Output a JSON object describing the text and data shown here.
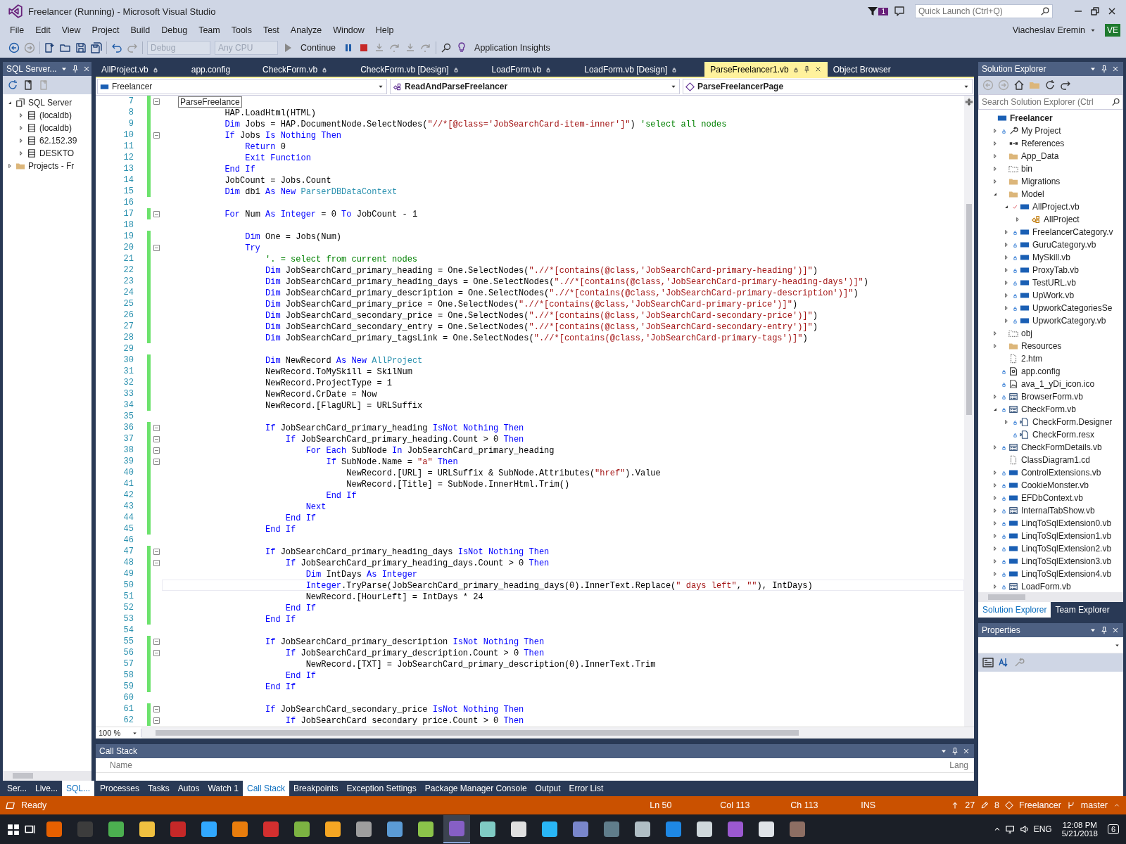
{
  "window": {
    "title": "Freelancer (Running) - Microsoft Visual Studio",
    "notification_count": "1",
    "quick_launch": {
      "placeholder": "Quick Launch (Ctrl+Q)"
    }
  },
  "menu": [
    "File",
    "Edit",
    "View",
    "Project",
    "Build",
    "Debug",
    "Team",
    "Tools",
    "Test",
    "Analyze",
    "Window",
    "Help"
  ],
  "account": {
    "name": "Viacheslav Eremin",
    "initials": "VE"
  },
  "toolbar": {
    "configuration": {
      "value": "Debug",
      "disabled": true
    },
    "platform": {
      "value": "Any CPU",
      "disabled": true
    },
    "continue": "Continue",
    "insights": "Application Insights"
  },
  "sql_panel": {
    "title": "SQL Server...",
    "items": [
      {
        "label": "SQL Server",
        "kind": "server-group",
        "expanded": true,
        "children": [
          {
            "label": "(localdb)",
            "kind": "server",
            "expanded": false
          },
          {
            "label": "(localdb)",
            "kind": "server",
            "expanded": false
          },
          {
            "label": "62.152.39",
            "kind": "server",
            "expanded": false
          },
          {
            "label": "DESKTO",
            "kind": "server",
            "expanded": false
          }
        ]
      },
      {
        "label": "Projects - Fr",
        "kind": "folder",
        "expanded": false
      }
    ],
    "tabs": [
      {
        "label": "Ser...",
        "selected": false
      },
      {
        "label": "Live...",
        "selected": false
      },
      {
        "label": "SQL...",
        "selected": true
      }
    ]
  },
  "doc_tabs": [
    {
      "label": "AllProject.vb",
      "locked": true,
      "selected": false
    },
    {
      "label": "app.config",
      "locked": false,
      "selected": false
    },
    {
      "label": "CheckForm.vb",
      "locked": true,
      "selected": false
    },
    {
      "label": "CheckForm.vb [Design]",
      "locked": true,
      "selected": false
    },
    {
      "label": "LoadForm.vb",
      "locked": true,
      "selected": false
    },
    {
      "label": "LoadForm.vb [Design]",
      "locked": true,
      "selected": false
    },
    {
      "label": "ParseFreelancer1.vb",
      "locked": true,
      "selected": true
    },
    {
      "label": "Object Browser",
      "locked": false,
      "selected": false
    }
  ],
  "nav_bar": {
    "project": "Freelancer",
    "type": "ReadAndParseFreelancer",
    "member": "ParseFreelancerPage"
  },
  "editor": {
    "zoom": "100 %",
    "lines": [
      {
        "n": "7",
        "changed": true,
        "fold": true,
        "current": false,
        "tooltip": "ParseFreelance"
      },
      {
        "n": "8",
        "changed": true,
        "fold": false,
        "current": false,
        "tokens": [
          {
            "kind": "plain",
            "text": "            HAP.LoadHtml(HTML)"
          }
        ]
      },
      {
        "n": "9",
        "changed": true,
        "fold": false,
        "current": false,
        "tokens": [
          {
            "kind": "keyword",
            "text": "            Dim"
          },
          {
            "kind": "plain",
            "text": " Jobs = HAP.DocumentNode.SelectNodes("
          },
          {
            "kind": "string",
            "text": "\"//*[@class='JobSearchCard-item-inner']\""
          },
          {
            "kind": "plain",
            "text": ") "
          },
          {
            "kind": "comment",
            "text": "'select all nodes"
          }
        ]
      },
      {
        "n": "10",
        "changed": true,
        "fold": true,
        "current": false,
        "tokens": [
          {
            "kind": "keyword",
            "text": "            If"
          },
          {
            "kind": "plain",
            "text": " Jobs "
          },
          {
            "kind": "keyword",
            "text": "Is Nothing Then"
          }
        ]
      },
      {
        "n": "11",
        "changed": true,
        "fold": false,
        "current": false,
        "tokens": [
          {
            "kind": "keyword",
            "text": "                Return"
          },
          {
            "kind": "plain",
            "text": " 0"
          }
        ]
      },
      {
        "n": "12",
        "changed": true,
        "fold": false,
        "current": false,
        "tokens": [
          {
            "kind": "keyword",
            "text": "                Exit Function"
          }
        ]
      },
      {
        "n": "13",
        "changed": true,
        "fold": false,
        "current": false,
        "tokens": [
          {
            "kind": "keyword",
            "text": "            End If"
          }
        ]
      },
      {
        "n": "14",
        "changed": true,
        "fold": false,
        "current": false,
        "tokens": [
          {
            "kind": "plain",
            "text": "            JobCount = Jobs.Count"
          }
        ]
      },
      {
        "n": "15",
        "changed": true,
        "fold": false,
        "current": false,
        "tokens": [
          {
            "kind": "keyword",
            "text": "            Dim"
          },
          {
            "kind": "plain",
            "text": " db1 "
          },
          {
            "kind": "keyword",
            "text": "As New "
          },
          {
            "kind": "type",
            "text": "ParserDBDataContext"
          }
        ]
      },
      {
        "n": "16",
        "changed": false,
        "fold": false,
        "current": false
      },
      {
        "n": "17",
        "changed": true,
        "fold": true,
        "current": false,
        "tokens": [
          {
            "kind": "keyword",
            "text": "            For"
          },
          {
            "kind": "plain",
            "text": " Num "
          },
          {
            "kind": "keyword",
            "text": "As Integer"
          },
          {
            "kind": "plain",
            "text": " = 0 "
          },
          {
            "kind": "keyword",
            "text": "To"
          },
          {
            "kind": "plain",
            "text": " JobCount - 1"
          }
        ]
      },
      {
        "n": "18",
        "changed": false,
        "fold": false,
        "current": false
      },
      {
        "n": "19",
        "changed": true,
        "fold": false,
        "current": false,
        "tokens": [
          {
            "kind": "keyword",
            "text": "                Dim"
          },
          {
            "kind": "plain",
            "text": " One = Jobs(Num)"
          }
        ]
      },
      {
        "n": "20",
        "changed": true,
        "fold": true,
        "current": false,
        "tokens": [
          {
            "kind": "keyword",
            "text": "                Try"
          }
        ]
      },
      {
        "n": "21",
        "changed": true,
        "fold": false,
        "current": false,
        "tokens": [
          {
            "kind": "comment",
            "text": "                    '. = select from current nodes"
          }
        ]
      },
      {
        "n": "22",
        "changed": true,
        "fold": false,
        "current": false,
        "tokens": [
          {
            "kind": "keyword",
            "text": "                    Dim"
          },
          {
            "kind": "plain",
            "text": " JobSearchCard_primary_heading = One.SelectNodes("
          },
          {
            "kind": "string",
            "text": "\".//*[contains(@class,'JobSearchCard-primary-heading')]\""
          },
          {
            "kind": "plain",
            "text": ")"
          }
        ]
      },
      {
        "n": "23",
        "changed": true,
        "fold": false,
        "current": false,
        "tokens": [
          {
            "kind": "keyword",
            "text": "                    Dim"
          },
          {
            "kind": "plain",
            "text": " JobSearchCard_primary_heading_days = One.SelectNodes("
          },
          {
            "kind": "string",
            "text": "\".//*[contains(@class,'JobSearchCard-primary-heading-days')]\""
          },
          {
            "kind": "plain",
            "text": ")"
          }
        ]
      },
      {
        "n": "24",
        "changed": true,
        "fold": false,
        "current": false,
        "tokens": [
          {
            "kind": "keyword",
            "text": "                    Dim"
          },
          {
            "kind": "plain",
            "text": " JobSearchCard_primary_description = One.SelectNodes("
          },
          {
            "kind": "string",
            "text": "\".//*[contains(@class,'JobSearchCard-primary-description')]\""
          },
          {
            "kind": "plain",
            "text": ")"
          }
        ]
      },
      {
        "n": "25",
        "changed": true,
        "fold": false,
        "current": false,
        "tokens": [
          {
            "kind": "keyword",
            "text": "                    Dim"
          },
          {
            "kind": "plain",
            "text": " JobSearchCard_primary_price = One.SelectNodes("
          },
          {
            "kind": "string",
            "text": "\".//*[contains(@class,'JobSearchCard-primary-price')]\""
          },
          {
            "kind": "plain",
            "text": ")"
          }
        ]
      },
      {
        "n": "26",
        "changed": true,
        "fold": false,
        "current": false,
        "tokens": [
          {
            "kind": "keyword",
            "text": "                    Dim"
          },
          {
            "kind": "plain",
            "text": " JobSearchCard_secondary_price = One.SelectNodes("
          },
          {
            "kind": "string",
            "text": "\".//*[contains(@class,'JobSearchCard-secondary-price')]\""
          },
          {
            "kind": "plain",
            "text": ")"
          }
        ]
      },
      {
        "n": "27",
        "changed": true,
        "fold": false,
        "current": false,
        "tokens": [
          {
            "kind": "keyword",
            "text": "                    Dim"
          },
          {
            "kind": "plain",
            "text": " JobSearchCard_secondary_entry = One.SelectNodes("
          },
          {
            "kind": "string",
            "text": "\".//*[contains(@class,'JobSearchCard-secondary-entry')]\""
          },
          {
            "kind": "plain",
            "text": ")"
          }
        ]
      },
      {
        "n": "28",
        "changed": true,
        "fold": false,
        "current": false,
        "tokens": [
          {
            "kind": "keyword",
            "text": "                    Dim"
          },
          {
            "kind": "plain",
            "text": " JobSearchCard_primary_tagsLink = One.SelectNodes("
          },
          {
            "kind": "string",
            "text": "\".//*[contains(@class,'JobSearchCard-primary-tags')]\""
          },
          {
            "kind": "plain",
            "text": ")"
          }
        ]
      },
      {
        "n": "29",
        "changed": false,
        "fold": false,
        "current": false
      },
      {
        "n": "30",
        "changed": true,
        "fold": false,
        "current": false,
        "tokens": [
          {
            "kind": "keyword",
            "text": "                    Dim"
          },
          {
            "kind": "plain",
            "text": " NewRecord "
          },
          {
            "kind": "keyword",
            "text": "As New "
          },
          {
            "kind": "type",
            "text": "AllProject"
          }
        ]
      },
      {
        "n": "31",
        "changed": true,
        "fold": false,
        "current": false,
        "tokens": [
          {
            "kind": "plain",
            "text": "                    NewRecord.ToMySkill = SkilNum"
          }
        ]
      },
      {
        "n": "32",
        "changed": true,
        "fold": false,
        "current": false,
        "tokens": [
          {
            "kind": "plain",
            "text": "                    NewRecord.ProjectType = 1"
          }
        ]
      },
      {
        "n": "33",
        "changed": true,
        "fold": false,
        "current": false,
        "tokens": [
          {
            "kind": "plain",
            "text": "                    NewRecord.CrDate = Now"
          }
        ]
      },
      {
        "n": "34",
        "changed": true,
        "fold": false,
        "current": false,
        "tokens": [
          {
            "kind": "plain",
            "text": "                    NewRecord.[FlagURL] = URLSuffix"
          }
        ]
      },
      {
        "n": "35",
        "changed": false,
        "fold": false,
        "current": false
      },
      {
        "n": "36",
        "changed": true,
        "fold": true,
        "current": false,
        "tokens": [
          {
            "kind": "keyword",
            "text": "                    If"
          },
          {
            "kind": "plain",
            "text": " JobSearchCard_primary_heading "
          },
          {
            "kind": "keyword",
            "text": "IsNot Nothing Then"
          }
        ]
      },
      {
        "n": "37",
        "changed": true,
        "fold": true,
        "current": false,
        "tokens": [
          {
            "kind": "keyword",
            "text": "                        If"
          },
          {
            "kind": "plain",
            "text": " JobSearchCard_primary_heading.Count > 0 "
          },
          {
            "kind": "keyword",
            "text": "Then"
          }
        ]
      },
      {
        "n": "38",
        "changed": true,
        "fold": true,
        "current": false,
        "tokens": [
          {
            "kind": "keyword",
            "text": "                            For Each"
          },
          {
            "kind": "plain",
            "text": " SubNode "
          },
          {
            "kind": "keyword",
            "text": "In"
          },
          {
            "kind": "plain",
            "text": " JobSearchCard_primary_heading"
          }
        ]
      },
      {
        "n": "39",
        "changed": true,
        "fold": true,
        "current": false,
        "tokens": [
          {
            "kind": "keyword",
            "text": "                                If"
          },
          {
            "kind": "plain",
            "text": " SubNode.Name = "
          },
          {
            "kind": "string",
            "text": "\"a\""
          },
          {
            "kind": "keyword",
            "text": " Then"
          }
        ]
      },
      {
        "n": "40",
        "changed": true,
        "fold": false,
        "current": false,
        "tokens": [
          {
            "kind": "plain",
            "text": "                                    NewRecord.[URL] = URLSuffix & SubNode.Attributes("
          },
          {
            "kind": "string",
            "text": "\"href\""
          },
          {
            "kind": "plain",
            "text": ").Value"
          }
        ]
      },
      {
        "n": "41",
        "changed": true,
        "fold": false,
        "current": false,
        "tokens": [
          {
            "kind": "plain",
            "text": "                                    NewRecord.[Title] = SubNode.InnerHtml.Trim()"
          }
        ]
      },
      {
        "n": "42",
        "changed": true,
        "fold": false,
        "current": false,
        "tokens": [
          {
            "kind": "keyword",
            "text": "                                End If"
          }
        ]
      },
      {
        "n": "43",
        "changed": true,
        "fold": false,
        "current": false,
        "tokens": [
          {
            "kind": "keyword",
            "text": "                            Next"
          }
        ]
      },
      {
        "n": "44",
        "changed": true,
        "fold": false,
        "current": false,
        "tokens": [
          {
            "kind": "keyword",
            "text": "                        End If"
          }
        ]
      },
      {
        "n": "45",
        "changed": true,
        "fold": false,
        "current": false,
        "tokens": [
          {
            "kind": "keyword",
            "text": "                    End If"
          }
        ]
      },
      {
        "n": "46",
        "changed": false,
        "fold": false,
        "current": false
      },
      {
        "n": "47",
        "changed": true,
        "fold": true,
        "current": false,
        "tokens": [
          {
            "kind": "keyword",
            "text": "                    If"
          },
          {
            "kind": "plain",
            "text": " JobSearchCard_primary_heading_days "
          },
          {
            "kind": "keyword",
            "text": "IsNot Nothing Then"
          }
        ]
      },
      {
        "n": "48",
        "changed": true,
        "fold": true,
        "current": false,
        "tokens": [
          {
            "kind": "keyword",
            "text": "                        If"
          },
          {
            "kind": "plain",
            "text": " JobSearchCard_primary_heading_days.Count > 0 "
          },
          {
            "kind": "keyword",
            "text": "Then"
          }
        ]
      },
      {
        "n": "49",
        "changed": true,
        "fold": false,
        "current": false,
        "tokens": [
          {
            "kind": "keyword",
            "text": "                            Dim"
          },
          {
            "kind": "plain",
            "text": " IntDays "
          },
          {
            "kind": "keyword",
            "text": "As Integer"
          }
        ]
      },
      {
        "n": "50",
        "changed": true,
        "fold": false,
        "current": true,
        "tokens": [
          {
            "kind": "keyword",
            "text": "                            Integer"
          },
          {
            "kind": "plain",
            "text": ".TryParse(JobSearchCard_primary_heading_days(0).InnerText.Replace("
          },
          {
            "kind": "string",
            "text": "\" days left\""
          },
          {
            "kind": "plain",
            "text": ", "
          },
          {
            "kind": "string",
            "text": "\"\""
          },
          {
            "kind": "plain",
            "text": "), IntDays)"
          }
        ]
      },
      {
        "n": "51",
        "changed": true,
        "fold": false,
        "current": false,
        "tokens": [
          {
            "kind": "plain",
            "text": "                            NewRecord.[HourLeft] = IntDays * 24"
          }
        ]
      },
      {
        "n": "52",
        "changed": true,
        "fold": false,
        "current": false,
        "tokens": [
          {
            "kind": "keyword",
            "text": "                        End If"
          }
        ]
      },
      {
        "n": "53",
        "changed": true,
        "fold": false,
        "current": false,
        "tokens": [
          {
            "kind": "keyword",
            "text": "                    End If"
          }
        ]
      },
      {
        "n": "54",
        "changed": false,
        "fold": false,
        "current": false
      },
      {
        "n": "55",
        "changed": true,
        "fold": true,
        "current": false,
        "tokens": [
          {
            "kind": "keyword",
            "text": "                    If"
          },
          {
            "kind": "plain",
            "text": " JobSearchCard_primary_description "
          },
          {
            "kind": "keyword",
            "text": "IsNot Nothing Then"
          }
        ]
      },
      {
        "n": "56",
        "changed": true,
        "fold": true,
        "current": false,
        "tokens": [
          {
            "kind": "keyword",
            "text": "                        If"
          },
          {
            "kind": "plain",
            "text": " JobSearchCard_primary_description.Count > 0 "
          },
          {
            "kind": "keyword",
            "text": "Then"
          }
        ]
      },
      {
        "n": "57",
        "changed": true,
        "fold": false,
        "current": false,
        "tokens": [
          {
            "kind": "plain",
            "text": "                            NewRecord.[TXT] = JobSearchCard_primary_description(0).InnerText.Trim"
          }
        ]
      },
      {
        "n": "58",
        "changed": true,
        "fold": false,
        "current": false,
        "tokens": [
          {
            "kind": "keyword",
            "text": "                        End If"
          }
        ]
      },
      {
        "n": "59",
        "changed": true,
        "fold": false,
        "current": false,
        "tokens": [
          {
            "kind": "keyword",
            "text": "                    End If"
          }
        ]
      },
      {
        "n": "60",
        "changed": false,
        "fold": false,
        "current": false
      },
      {
        "n": "61",
        "changed": true,
        "fold": true,
        "current": false,
        "tokens": [
          {
            "kind": "keyword",
            "text": "                    If"
          },
          {
            "kind": "plain",
            "text": " JobSearchCard_secondary_price "
          },
          {
            "kind": "keyword",
            "text": "IsNot Nothing Then"
          }
        ]
      },
      {
        "n": "62",
        "changed": true,
        "fold": true,
        "current": false,
        "tokens": [
          {
            "kind": "keyword",
            "text": "                        If"
          },
          {
            "kind": "plain",
            "text": " JobSearchCard secondary price.Count > 0 "
          },
          {
            "kind": "keyword",
            "text": "Then"
          }
        ]
      }
    ]
  },
  "call_stack": {
    "title": "Call Stack",
    "columns": [
      "Name",
      "Lang"
    ]
  },
  "bottom_tabs": [
    {
      "label": "Processes",
      "selected": false
    },
    {
      "label": "Tasks",
      "selected": false
    },
    {
      "label": "Autos",
      "selected": false
    },
    {
      "label": "Watch 1",
      "selected": false
    },
    {
      "label": "Call Stack",
      "selected": true
    },
    {
      "label": "Breakpoints",
      "selected": false
    },
    {
      "label": "Exception Settings",
      "selected": false
    },
    {
      "label": "Package Manager Console",
      "selected": false
    },
    {
      "label": "Output",
      "selected": false
    },
    {
      "label": "Error List",
      "selected": false
    }
  ],
  "solution_explorer": {
    "title": "Solution Explorer",
    "search": {
      "placeholder": "Search Solution Explorer (Ctrl"
    },
    "items": [
      {
        "label": "Freelancer",
        "kind": "project",
        "locked": false,
        "checked_out": false,
        "children": [
          {
            "label": "My Project",
            "kind": "wrench",
            "expanded": false,
            "locked": true,
            "checked_out": false
          },
          {
            "label": "References",
            "kind": "refs",
            "expanded": false,
            "locked": false,
            "checked_out": false
          },
          {
            "label": "App_Data",
            "kind": "folder",
            "expanded": false,
            "locked": false,
            "checked_out": false
          },
          {
            "label": "bin",
            "kind": "hidden-folder",
            "expanded": false,
            "locked": false,
            "checked_out": false
          },
          {
            "label": "Migrations",
            "kind": "folder",
            "expanded": false,
            "locked": false,
            "checked_out": false
          },
          {
            "label": "Model",
            "kind": "folder",
            "expanded": true,
            "locked": false,
            "checked_out": false,
            "children": [
              {
                "label": "AllProject.vb",
                "kind": "vb",
                "expanded": true,
                "locked": false,
                "checked_out": true,
                "children": [
                  {
                    "label": "AllProject",
                    "kind": "class",
                    "expanded": false,
                    "locked": false,
                    "checked_out": false
                  }
                ]
              },
              {
                "label": "FreelancerCategory.v",
                "kind": "vb",
                "expanded": false,
                "locked": true,
                "checked_out": false
              },
              {
                "label": "GuruCategory.vb",
                "kind": "vb",
                "expanded": false,
                "locked": true,
                "checked_out": false
              },
              {
                "label": "MySkill.vb",
                "kind": "vb",
                "expanded": false,
                "locked": true,
                "checked_out": false
              },
              {
                "label": "ProxyTab.vb",
                "kind": "vb",
                "expanded": false,
                "locked": true,
                "checked_out": false
              },
              {
                "label": "TestURL.vb",
                "kind": "vb",
                "expanded": false,
                "locked": true,
                "checked_out": false
              },
              {
                "label": "UpWork.vb",
                "kind": "vb",
                "expanded": false,
                "locked": true,
                "checked_out": false
              },
              {
                "label": "UpworkCategoriesSe",
                "kind": "vb",
                "expanded": false,
                "locked": true,
                "checked_out": false
              },
              {
                "label": "UpworkCategory.vb",
                "kind": "vb",
                "expanded": false,
                "locked": true,
                "checked_out": false
              }
            ]
          },
          {
            "label": "obj",
            "kind": "hidden-folder",
            "expanded": false,
            "locked": false,
            "checked_out": false
          },
          {
            "label": "Resources",
            "kind": "folder",
            "expanded": false,
            "locked": false,
            "checked_out": false
          },
          {
            "label": "2.htm",
            "kind": "hidden-file",
            "locked": false,
            "checked_out": false
          },
          {
            "label": "app.config",
            "kind": "config",
            "locked": true,
            "checked_out": false
          },
          {
            "label": "ava_1_yDi_icon.ico",
            "kind": "image",
            "locked": true,
            "checked_out": false
          },
          {
            "label": "BrowserForm.vb",
            "kind": "form",
            "expanded": false,
            "locked": true,
            "checked_out": false
          },
          {
            "label": "CheckForm.vb",
            "kind": "form",
            "expanded": true,
            "locked": true,
            "checked_out": false,
            "children": [
              {
                "label": "CheckForm.Designer",
                "kind": "designer",
                "expanded": false,
                "locked": true,
                "checked_out": false
              },
              {
                "label": "CheckForm.resx",
                "kind": "designer",
                "locked": true,
                "checked_out": false
              }
            ]
          },
          {
            "label": "CheckFormDetails.vb",
            "kind": "form",
            "expanded": false,
            "locked": true,
            "checked_out": false
          },
          {
            "label": "ClassDiagram1.cd",
            "kind": "hidden-file",
            "locked": false,
            "checked_out": false
          },
          {
            "label": "ControlExtensions.vb",
            "kind": "vb",
            "expanded": false,
            "locked": true,
            "checked_out": false
          },
          {
            "label": "CookieMonster.vb",
            "kind": "vb",
            "expanded": false,
            "locked": true,
            "checked_out": false
          },
          {
            "label": "EFDbContext.vb",
            "kind": "vb",
            "expanded": false,
            "locked": true,
            "checked_out": false
          },
          {
            "label": "InternalTabShow.vb",
            "kind": "form",
            "expanded": false,
            "locked": true,
            "checked_out": false
          },
          {
            "label": "LinqToSqlExtension0.vb",
            "kind": "vb",
            "expanded": false,
            "locked": true,
            "checked_out": false
          },
          {
            "label": "LinqToSqlExtension1.vb",
            "kind": "vb",
            "expanded": false,
            "locked": true,
            "checked_out": false
          },
          {
            "label": "LinqToSqlExtension2.vb",
            "kind": "vb",
            "expanded": false,
            "locked": true,
            "checked_out": false
          },
          {
            "label": "LinqToSqlExtension3.vb",
            "kind": "vb",
            "expanded": false,
            "locked": true,
            "checked_out": false
          },
          {
            "label": "LinqToSqlExtension4.vb",
            "kind": "vb",
            "expanded": false,
            "locked": true,
            "checked_out": false
          },
          {
            "label": "LoadForm.vb",
            "kind": "form",
            "expanded": false,
            "locked": true,
            "checked_out": false
          }
        ]
      }
    ],
    "tabs": [
      {
        "label": "Solution Explorer",
        "selected": true
      },
      {
        "label": "Team Explorer",
        "selected": false
      }
    ]
  },
  "properties": {
    "title": "Properties"
  },
  "status_bar": {
    "message": "Ready",
    "line": "Ln 50",
    "col": "Col 113",
    "ch": "Ch 113",
    "mode": "INS",
    "pending": "27",
    "changes": "8",
    "repo": "Freelancer",
    "branch": "master"
  },
  "taskbar": {
    "apps": [
      {
        "color": "#e66000",
        "selected": false
      },
      {
        "color": "#3c3c3c",
        "selected": false
      },
      {
        "color": "#4caf50",
        "selected": false
      },
      {
        "color": "#f0c040",
        "selected": false
      },
      {
        "color": "#c62828",
        "selected": false
      },
      {
        "color": "#31a8ff",
        "selected": false
      },
      {
        "color": "#e87d0d",
        "selected": false
      },
      {
        "color": "#d32f2f",
        "selected": false
      },
      {
        "color": "#7cb342",
        "selected": false
      },
      {
        "color": "#f5a623",
        "selected": false
      },
      {
        "color": "#9e9e9e",
        "selected": false
      },
      {
        "color": "#5b9bd5",
        "selected": false
      },
      {
        "color": "#8bc34a",
        "selected": false
      },
      {
        "color": "#865fc5",
        "selected": true
      },
      {
        "color": "#80cbc4",
        "selected": false
      },
      {
        "color": "#e0e0e0",
        "selected": false
      },
      {
        "color": "#29b6f6",
        "selected": false
      },
      {
        "color": "#7986cb",
        "selected": false
      },
      {
        "color": "#607d8b",
        "selected": false
      },
      {
        "color": "#b0bec5",
        "selected": false
      },
      {
        "color": "#1e88e5",
        "selected": false
      },
      {
        "color": "#cfd8dc",
        "selected": false
      },
      {
        "color": "#9b59d0",
        "selected": false
      },
      {
        "color": "#dfe3e8",
        "selected": false
      },
      {
        "color": "#8d6e63",
        "selected": false
      }
    ],
    "language": "ENG",
    "time": "12:08 PM",
    "date": "5/21/2018",
    "notifications": "6"
  }
}
